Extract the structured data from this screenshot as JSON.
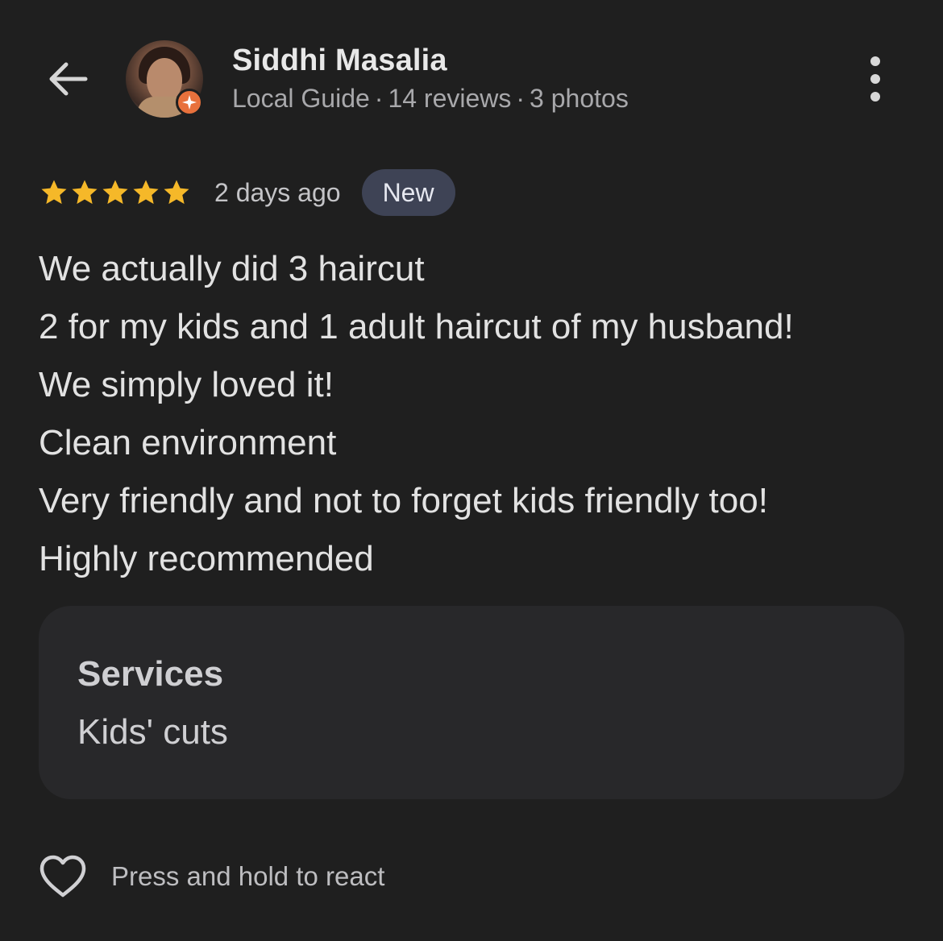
{
  "header": {
    "back_icon": "arrow-back-icon",
    "user": {
      "name": "Siddhi Masalia",
      "guide_label": "Local Guide",
      "reviews": "14 reviews",
      "photos": "3 photos",
      "separator": "·",
      "badge_icon": "local-guide-star-icon",
      "badge_color": "#e8713c"
    },
    "more_icon": "more-vert-icon"
  },
  "review": {
    "rating": 5,
    "rating_max": 5,
    "star_color": "#f5b829",
    "time_ago": "2 days ago",
    "badge": "New",
    "lines": [
      "We actually did 3 haircut",
      "2 for my kids and 1 adult haircut of my husband!",
      "We simply loved it!",
      "Clean environment",
      "Very friendly and not to forget kids friendly too!",
      "Highly recommended"
    ]
  },
  "services": {
    "title": "Services",
    "value": "Kids' cuts"
  },
  "react": {
    "icon": "heart-outline-icon",
    "label": "Press and hold to react"
  }
}
